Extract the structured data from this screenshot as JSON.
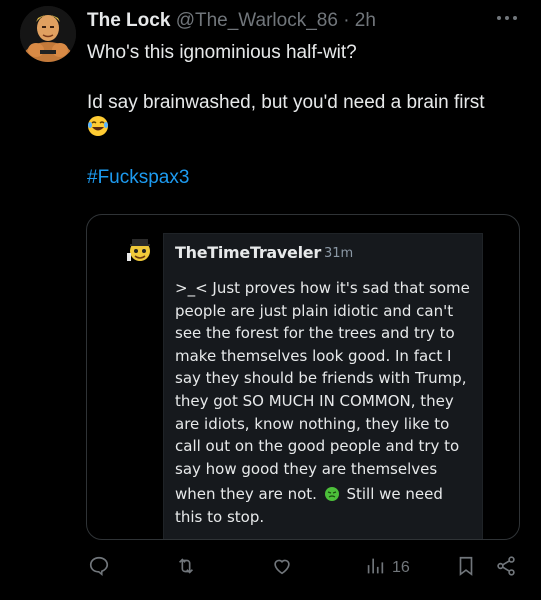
{
  "tweet": {
    "author_name": "The Lock",
    "author_handle": "@The_Warlock_86",
    "separator": "·",
    "time": "2h",
    "line1": "Who's this ignominious half-wit?",
    "line2": "Id say brainwashed, but you'd need a brain first",
    "emoji": "rolling-on-floor-laughing-emoji",
    "hashtag": "#Fuckspax3"
  },
  "quoted": {
    "author_name": "TheTimeTraveler",
    "time": "31m",
    "lines": [
      ">_< Just proves how it's sad that some",
      "people are just plain idiotic and can't",
      "see the forest for the trees and try to",
      "make themselves look good. In fact I",
      "say they should be friends with Trump,",
      "they got SO MUCH IN COMMON, they",
      "are idiots, know nothing, they like to",
      "call out on the good people and try to",
      "say how good they are themselves"
    ],
    "line_before_emoji": "when they are not.",
    "line_after_emoji": "Still we need",
    "last_line": "this to stop."
  },
  "actions": {
    "views": "16"
  },
  "colors": {
    "accent": "#1d9bf0",
    "muted": "#71767b",
    "background": "#000000"
  }
}
